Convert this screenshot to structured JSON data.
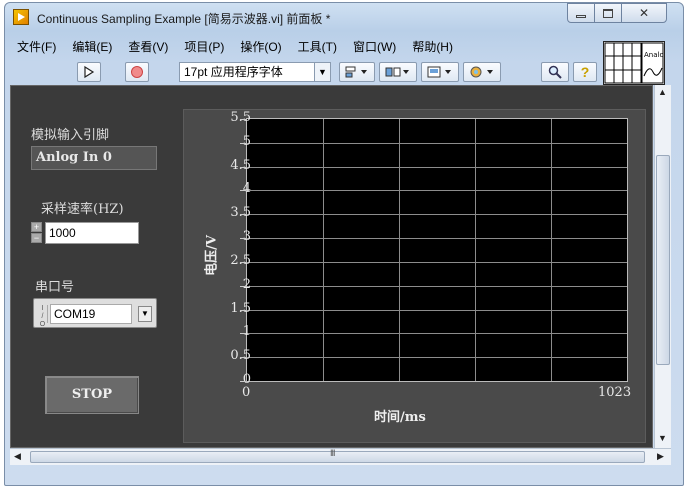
{
  "window": {
    "title": "Continuous Sampling Example  [简易示波器.vi] 前面板 *"
  },
  "menubar": {
    "items": [
      {
        "label": "文件(F)"
      },
      {
        "label": "编辑(E)"
      },
      {
        "label": "查看(V)"
      },
      {
        "label": "项目(P)"
      },
      {
        "label": "操作(O)"
      },
      {
        "label": "工具(T)"
      },
      {
        "label": "窗口(W)"
      },
      {
        "label": "帮助(H)"
      }
    ]
  },
  "toolbar": {
    "font": "17pt 应用程序字体",
    "icons": [
      "run-arrow-icon",
      "abort-icon",
      "align-icon",
      "distribute-icon",
      "resize-icon",
      "reorder-icon",
      "search-icon",
      "help-icon"
    ]
  },
  "vi_icon": {
    "text": "Analog"
  },
  "front_panel": {
    "analog_input_label": "模拟输入引脚",
    "analog_input_value": "Anlog In 0",
    "sample_rate_label": "采样速率(HZ)",
    "sample_rate_value": "1000",
    "serial_label": "串口号",
    "serial_value": "COM19",
    "stop_label": "STOP"
  },
  "chart_data": {
    "type": "line",
    "xlabel": "时间/ms",
    "ylabel": "电压/V",
    "xlim": [
      0,
      1023
    ],
    "ylim": [
      0,
      5.5
    ],
    "x_tick_labels": [
      "0",
      "1023"
    ],
    "y_tick_labels": [
      "0",
      "0.5",
      "1",
      "1.5",
      "2",
      "2.5",
      "3",
      "3.5",
      "4",
      "4.5",
      "5",
      "5.5"
    ],
    "grid": true,
    "series": []
  },
  "scrollbars": {
    "h_grip": "III"
  }
}
